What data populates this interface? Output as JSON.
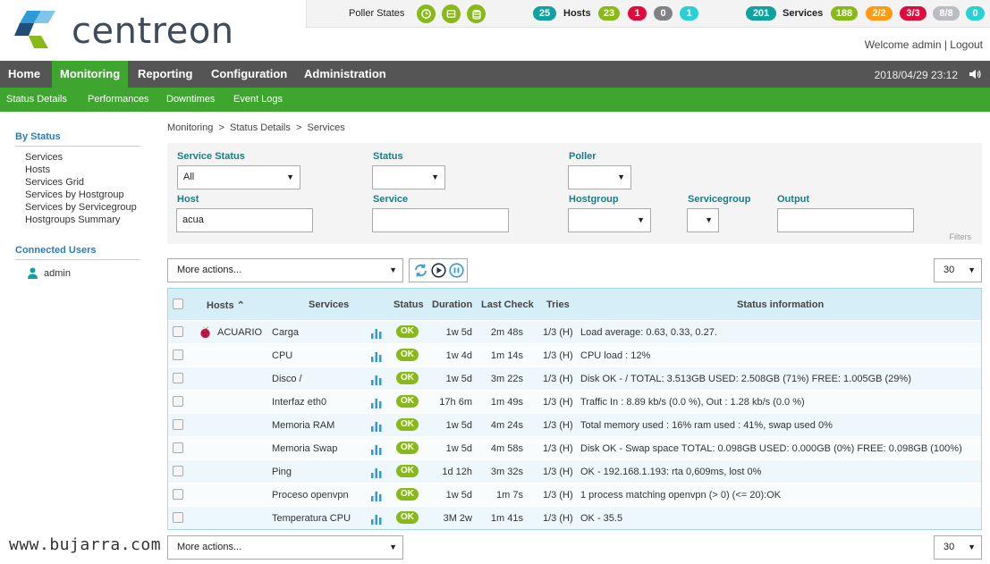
{
  "brand": {
    "name": "centreon",
    "colors": [
      "#2e9bd6",
      "#88b917",
      "#1f4e79"
    ]
  },
  "topbar": {
    "poller_states_label": "Poller States",
    "poller_icons": [
      "clock-icon",
      "database-icon",
      "stack-icon"
    ],
    "hosts_label": "Hosts",
    "hosts_total": "25",
    "hosts_counts": [
      {
        "value": "23",
        "color": "#88b917"
      },
      {
        "value": "1",
        "color": "#e00b3d"
      },
      {
        "value": "0",
        "color": "#818285"
      },
      {
        "value": "1",
        "color": "#2ad1d4"
      }
    ],
    "services_label": "Services",
    "services_total": "201",
    "services_counts": [
      {
        "value": "188",
        "color": "#88b917"
      },
      {
        "value": "2/2",
        "color": "#ff9a13"
      },
      {
        "value": "3/3",
        "color": "#e00b3d"
      },
      {
        "value": "8/8",
        "color": "#bcbdc0"
      },
      {
        "value": "0",
        "color": "#2ad1d4"
      }
    ],
    "total_color": "#10a2a0"
  },
  "user": {
    "welcome": "Welcome admin",
    "logout": "Logout"
  },
  "mainnav": {
    "items": [
      "Home",
      "Monitoring",
      "Reporting",
      "Configuration",
      "Administration"
    ],
    "datetime": "2018/04/29 23:12"
  },
  "subnav": {
    "items": [
      "Status  Details",
      "Performances",
      "Downtimes",
      "Event  Logs"
    ]
  },
  "sidebar": {
    "by_status": "By Status",
    "links": [
      "Services",
      "Hosts",
      "Services Grid",
      "Services by Hostgroup",
      "Services by Servicegroup",
      "Hostgroups Summary"
    ],
    "connected_users": "Connected Users",
    "user": "admin"
  },
  "breadcrumb": "Monitoring  >  Status Details  >  Services",
  "filters": {
    "service_status_label": "Service Status",
    "service_status_value": "All",
    "status_label": "Status",
    "poller_label": "Poller",
    "host_label": "Host",
    "host_value": "acua",
    "service_label": "Service",
    "hostgroup_label": "Hostgroup",
    "servicegroup_label": "Servicegroup",
    "output_label": "Output",
    "filters_word": "Filters"
  },
  "actions": {
    "more_actions": "More actions...",
    "page_size": "30"
  },
  "table": {
    "columns": [
      "Hosts",
      "Services",
      "Status",
      "Duration",
      "Last Check",
      "Tries",
      "Status information"
    ],
    "host": "ACUARIO",
    "rows": [
      {
        "service": "Carga",
        "status": "OK",
        "duration": "1w 5d",
        "last_check": "2m 48s",
        "tries": "1/3 (H)",
        "info": "Load average: 0.63, 0.33, 0.27."
      },
      {
        "service": "CPU",
        "status": "OK",
        "duration": "1w 4d",
        "last_check": "1m 14s",
        "tries": "1/3 (H)",
        "info": "CPU load : 12%"
      },
      {
        "service": "Disco /",
        "status": "OK",
        "duration": "1w 5d",
        "last_check": "3m 22s",
        "tries": "1/3 (H)",
        "info": "Disk OK - / TOTAL: 3.513GB USED: 2.508GB (71%) FREE: 1.005GB (29%)"
      },
      {
        "service": "Interfaz eth0",
        "status": "OK",
        "duration": "17h 6m",
        "last_check": "1m 49s",
        "tries": "1/3 (H)",
        "info": "Traffic In : 8.89 kb/s (0.0 %), Out : 1.28 kb/s (0.0 %)"
      },
      {
        "service": "Memoria RAM",
        "status": "OK",
        "duration": "1w 5d",
        "last_check": "4m 24s",
        "tries": "1/3 (H)",
        "info": "Total memory used : 16% ram used : 41%, swap used 0%"
      },
      {
        "service": "Memoria Swap",
        "status": "OK",
        "duration": "1w 5d",
        "last_check": "4m 58s",
        "tries": "1/3 (H)",
        "info": "Disk OK - Swap space TOTAL: 0.098GB USED: 0.000GB (0%) FREE: 0.098GB (100%)"
      },
      {
        "service": "Ping",
        "status": "OK",
        "duration": "1d 12h",
        "last_check": "3m 32s",
        "tries": "1/3 (H)",
        "info": "OK - 192.168.1.193: rta 0,609ms, lost 0%"
      },
      {
        "service": "Proceso openvpn",
        "status": "OK",
        "duration": "1w 5d",
        "last_check": "1m 7s",
        "tries": "1/3 (H)",
        "info": "1 process matching openvpn (> 0) (<= 20):OK"
      },
      {
        "service": "Temperatura CPU",
        "status": "OK",
        "duration": "3M 2w",
        "last_check": "1m 41s",
        "tries": "1/3 (H)",
        "info": "OK - 35.5"
      }
    ]
  },
  "watermark": "www.bujarra.com"
}
